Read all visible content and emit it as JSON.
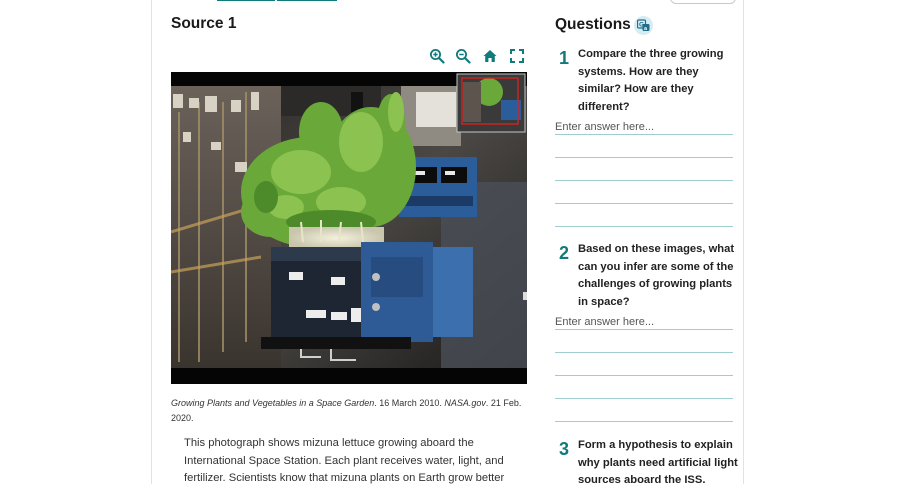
{
  "source": {
    "title": "Source 1",
    "toolbar": {
      "zoom_in_icon": "zoom-in-icon",
      "zoom_out_icon": "zoom-out-icon",
      "home_icon": "home-icon",
      "fullscreen_icon": "fullscreen-icon"
    },
    "image_alt": "Mizuna lettuce growing aboard the International Space Station",
    "caption": {
      "title_italic": "Growing Plants and Vegetables in a Space Garden",
      "date": ". 16 March 2010. ",
      "site_italic": "NASA.gov",
      "accessed": ". 21 Feb. 2020."
    },
    "body": "This photograph shows mizuna lettuce growing aboard the International Space Station. Each plant receives water, light, and fertilizer. Scientists know that mizuna plants on Earth grow better"
  },
  "questions_panel": {
    "title": "Questions",
    "icon": "translate-icon",
    "accent_color": "#117a7a",
    "items": [
      {
        "number": "1",
        "text": "Compare the three growing systems. How are they similar? How are they different?",
        "placeholder": "Enter answer here..."
      },
      {
        "number": "2",
        "text": "Based on these images, what can you infer are some of the challenges of growing plants in space?",
        "placeholder": "Enter answer here..."
      },
      {
        "number": "3",
        "text": "Form a hypothesis to explain why plants need artificial light sources aboard the ISS.",
        "placeholder": ""
      }
    ]
  }
}
